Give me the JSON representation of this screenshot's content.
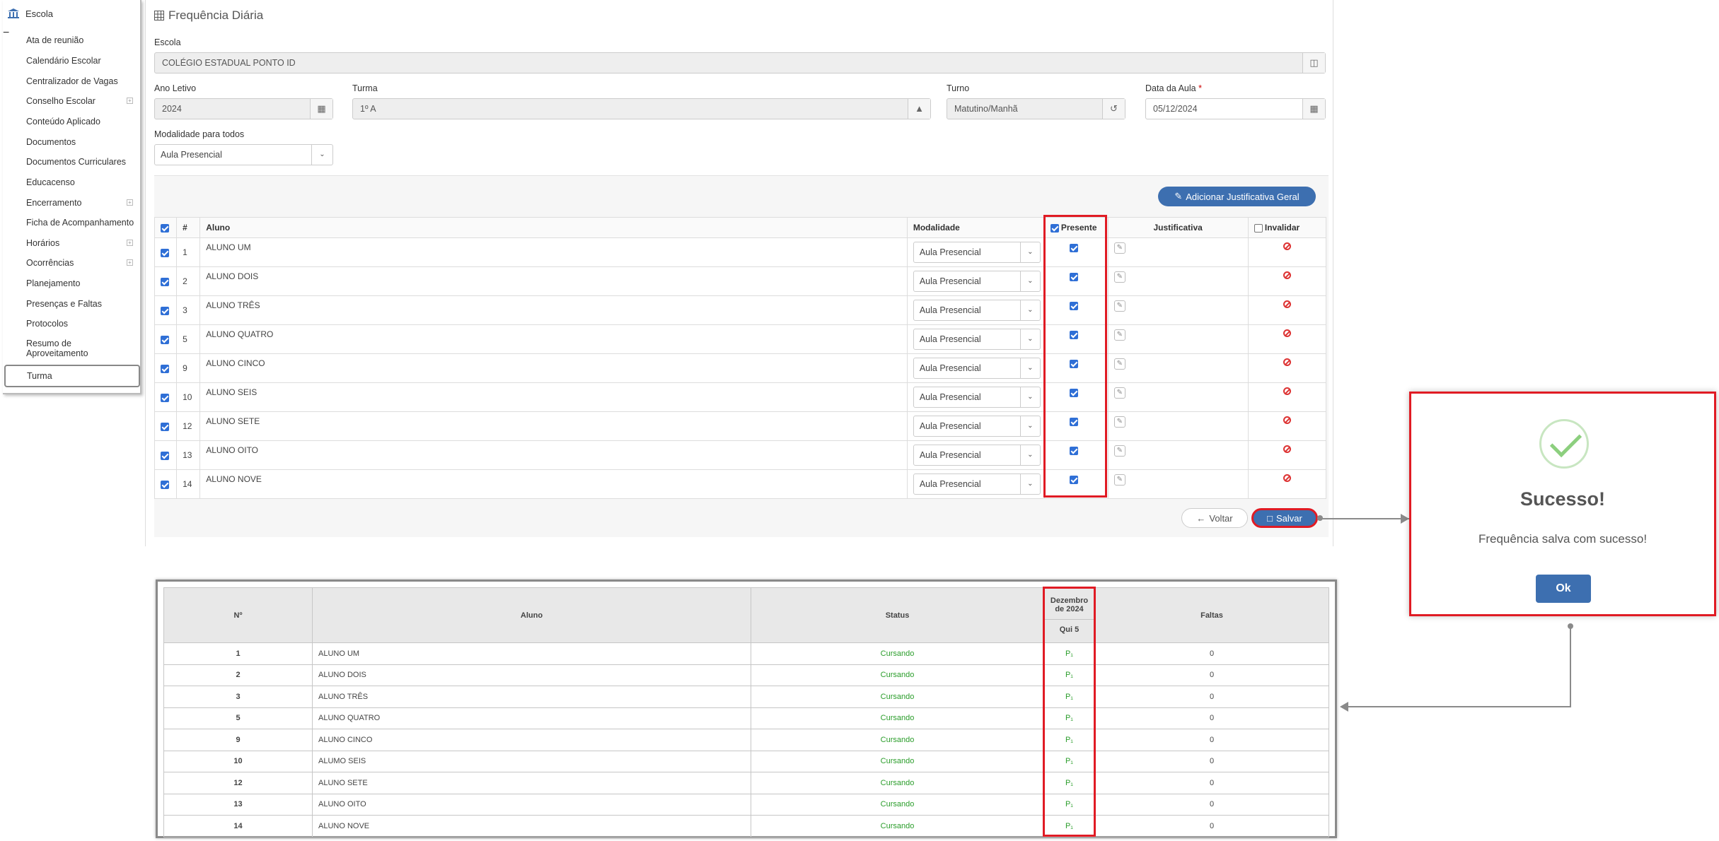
{
  "sidebar": {
    "header": "Escola",
    "items": [
      {
        "label": "Ata de reunião",
        "plus": false
      },
      {
        "label": "Calendário Escolar",
        "plus": false
      },
      {
        "label": "Centralizador de Vagas",
        "plus": false
      },
      {
        "label": "Conselho Escolar",
        "plus": true
      },
      {
        "label": "Conteúdo Aplicado",
        "plus": false
      },
      {
        "label": "Documentos",
        "plus": false
      },
      {
        "label": "Documentos Curriculares",
        "plus": false
      },
      {
        "label": "Educacenso",
        "plus": false
      },
      {
        "label": "Encerramento",
        "plus": true
      },
      {
        "label": "Ficha de Acompanhamento",
        "plus": false
      },
      {
        "label": "Horários",
        "plus": true
      },
      {
        "label": "Ocorrências",
        "plus": true
      },
      {
        "label": "Planejamento",
        "plus": false
      },
      {
        "label": "Presenças e Faltas",
        "plus": false
      },
      {
        "label": "Protocolos",
        "plus": false
      },
      {
        "label": "Resumo de",
        "label2": "Aproveitamento",
        "plus": false
      }
    ],
    "active": "Turma"
  },
  "form": {
    "title": "Frequência Diária",
    "escola_label": "Escola",
    "escola_value": "COLÉGIO ESTADUAL PONTO ID",
    "ano_label": "Ano Letivo",
    "ano_value": "2024",
    "turma_label": "Turma",
    "turma_value": "1º A",
    "turno_label": "Turno",
    "turno_value": "Matutino/Manhã",
    "data_label": "Data da Aula",
    "data_required": "*",
    "data_value": "05/12/2024",
    "modalidade_label": "Modalidade para todos",
    "modalidade_value": "Aula Presencial",
    "add_just_button": "Adicionar Justificativa Geral",
    "back_button": "Voltar",
    "save_button": "Salvar"
  },
  "attendance": {
    "headers": {
      "num": "#",
      "aluno": "Aluno",
      "modalidade": "Modalidade",
      "presente": "Presente",
      "justificativa": "Justificativa",
      "invalidar": "Invalidar"
    },
    "modalidade_value": "Aula Presencial",
    "rows": [
      {
        "num": "1",
        "name": "ALUNO UM"
      },
      {
        "num": "2",
        "name": "ALUNO DOIS"
      },
      {
        "num": "3",
        "name": "ALUNO TRÊS"
      },
      {
        "num": "5",
        "name": "ALUNO QUATRO"
      },
      {
        "num": "9",
        "name": "ALUNO CINCO"
      },
      {
        "num": "10",
        "name": "ALUNO SEIS"
      },
      {
        "num": "12",
        "name": "ALUNO SETE"
      },
      {
        "num": "13",
        "name": "ALUNO OITO"
      },
      {
        "num": "14",
        "name": "ALUNO NOVE"
      }
    ]
  },
  "report": {
    "headers": {
      "num": "Nº",
      "aluno": "Aluno",
      "status": "Status",
      "month": "Dezembro",
      "month2": "de 2024",
      "day": "Qui 5",
      "faltas": "Faltas"
    },
    "rows": [
      {
        "num": "1",
        "name": "ALUNO UM",
        "status": "Cursando",
        "mark": "P₁",
        "faltas": "0"
      },
      {
        "num": "2",
        "name": "ALUNO DOIS",
        "status": "Cursando",
        "mark": "P₁",
        "faltas": "0"
      },
      {
        "num": "3",
        "name": "ALUNO TRÊS",
        "status": "Cursando",
        "mark": "P₁",
        "faltas": "0"
      },
      {
        "num": "5",
        "name": "ALUNO QUATRO",
        "status": "Cursando",
        "mark": "P₁",
        "faltas": "0"
      },
      {
        "num": "9",
        "name": "ALUNO CINCO",
        "status": "Cursando",
        "mark": "P₁",
        "faltas": "0"
      },
      {
        "num": "10",
        "name": "ALUMO SEIS",
        "status": "Cursando",
        "mark": "P₁",
        "faltas": "0"
      },
      {
        "num": "12",
        "name": "ALUNO SETE",
        "status": "Cursando",
        "mark": "P₁",
        "faltas": "0"
      },
      {
        "num": "13",
        "name": "ALUNO OITO",
        "status": "Cursando",
        "mark": "P₁",
        "faltas": "0"
      },
      {
        "num": "14",
        "name": "ALUNO NOVE",
        "status": "Cursando",
        "mark": "P₁",
        "faltas": "0"
      }
    ]
  },
  "modal": {
    "title": "Sucesso!",
    "message": "Frequência salva com sucesso!",
    "ok_button": "Ok"
  },
  "colors": {
    "accent": "#3d6fb0",
    "highlight": "#e01b24",
    "success": "#2a9d2a"
  }
}
